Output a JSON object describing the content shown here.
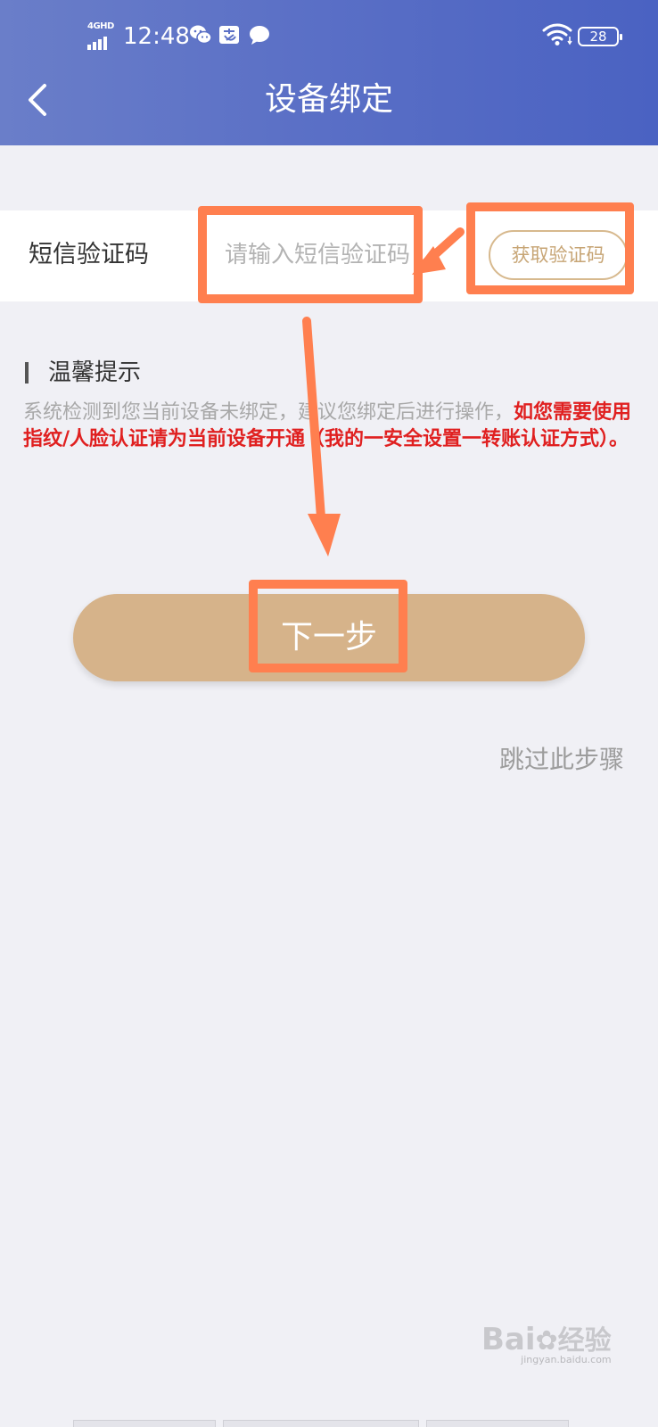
{
  "status_bar": {
    "network": "4GHD",
    "time": "12:48",
    "battery": "28",
    "icons": [
      "signal-icon",
      "wechat-icon",
      "alipay-icon",
      "message-icon",
      "wifi-icon",
      "battery-icon"
    ]
  },
  "header": {
    "title": "设备绑定",
    "back_icon": "chevron-left-icon"
  },
  "sms_row": {
    "label": "短信验证码",
    "placeholder": "请输入短信验证码",
    "value": "",
    "get_code_label": "获取验证码"
  },
  "tips": {
    "title": "温馨提示",
    "body_normal": "系统检测到您当前设备未绑定，建议您绑定后进行操作，",
    "body_highlight": "如您需要使用指纹/人脸认证请为当前设备开通（我的一安全设置一转账认证方式）。"
  },
  "actions": {
    "next_label": "下一步",
    "skip_label": "跳过此步骤"
  },
  "watermark": {
    "name": "Bai",
    "name_suffix": "经验",
    "sub": "jingyan.baidu.com"
  },
  "colors": {
    "header_start": "#6a7ec9",
    "header_end": "#4a62c2",
    "accent_gold": "#d6b38a",
    "annotation": "#ff7f4f",
    "warning_red": "#e02020",
    "background": "#f0f0f5"
  }
}
